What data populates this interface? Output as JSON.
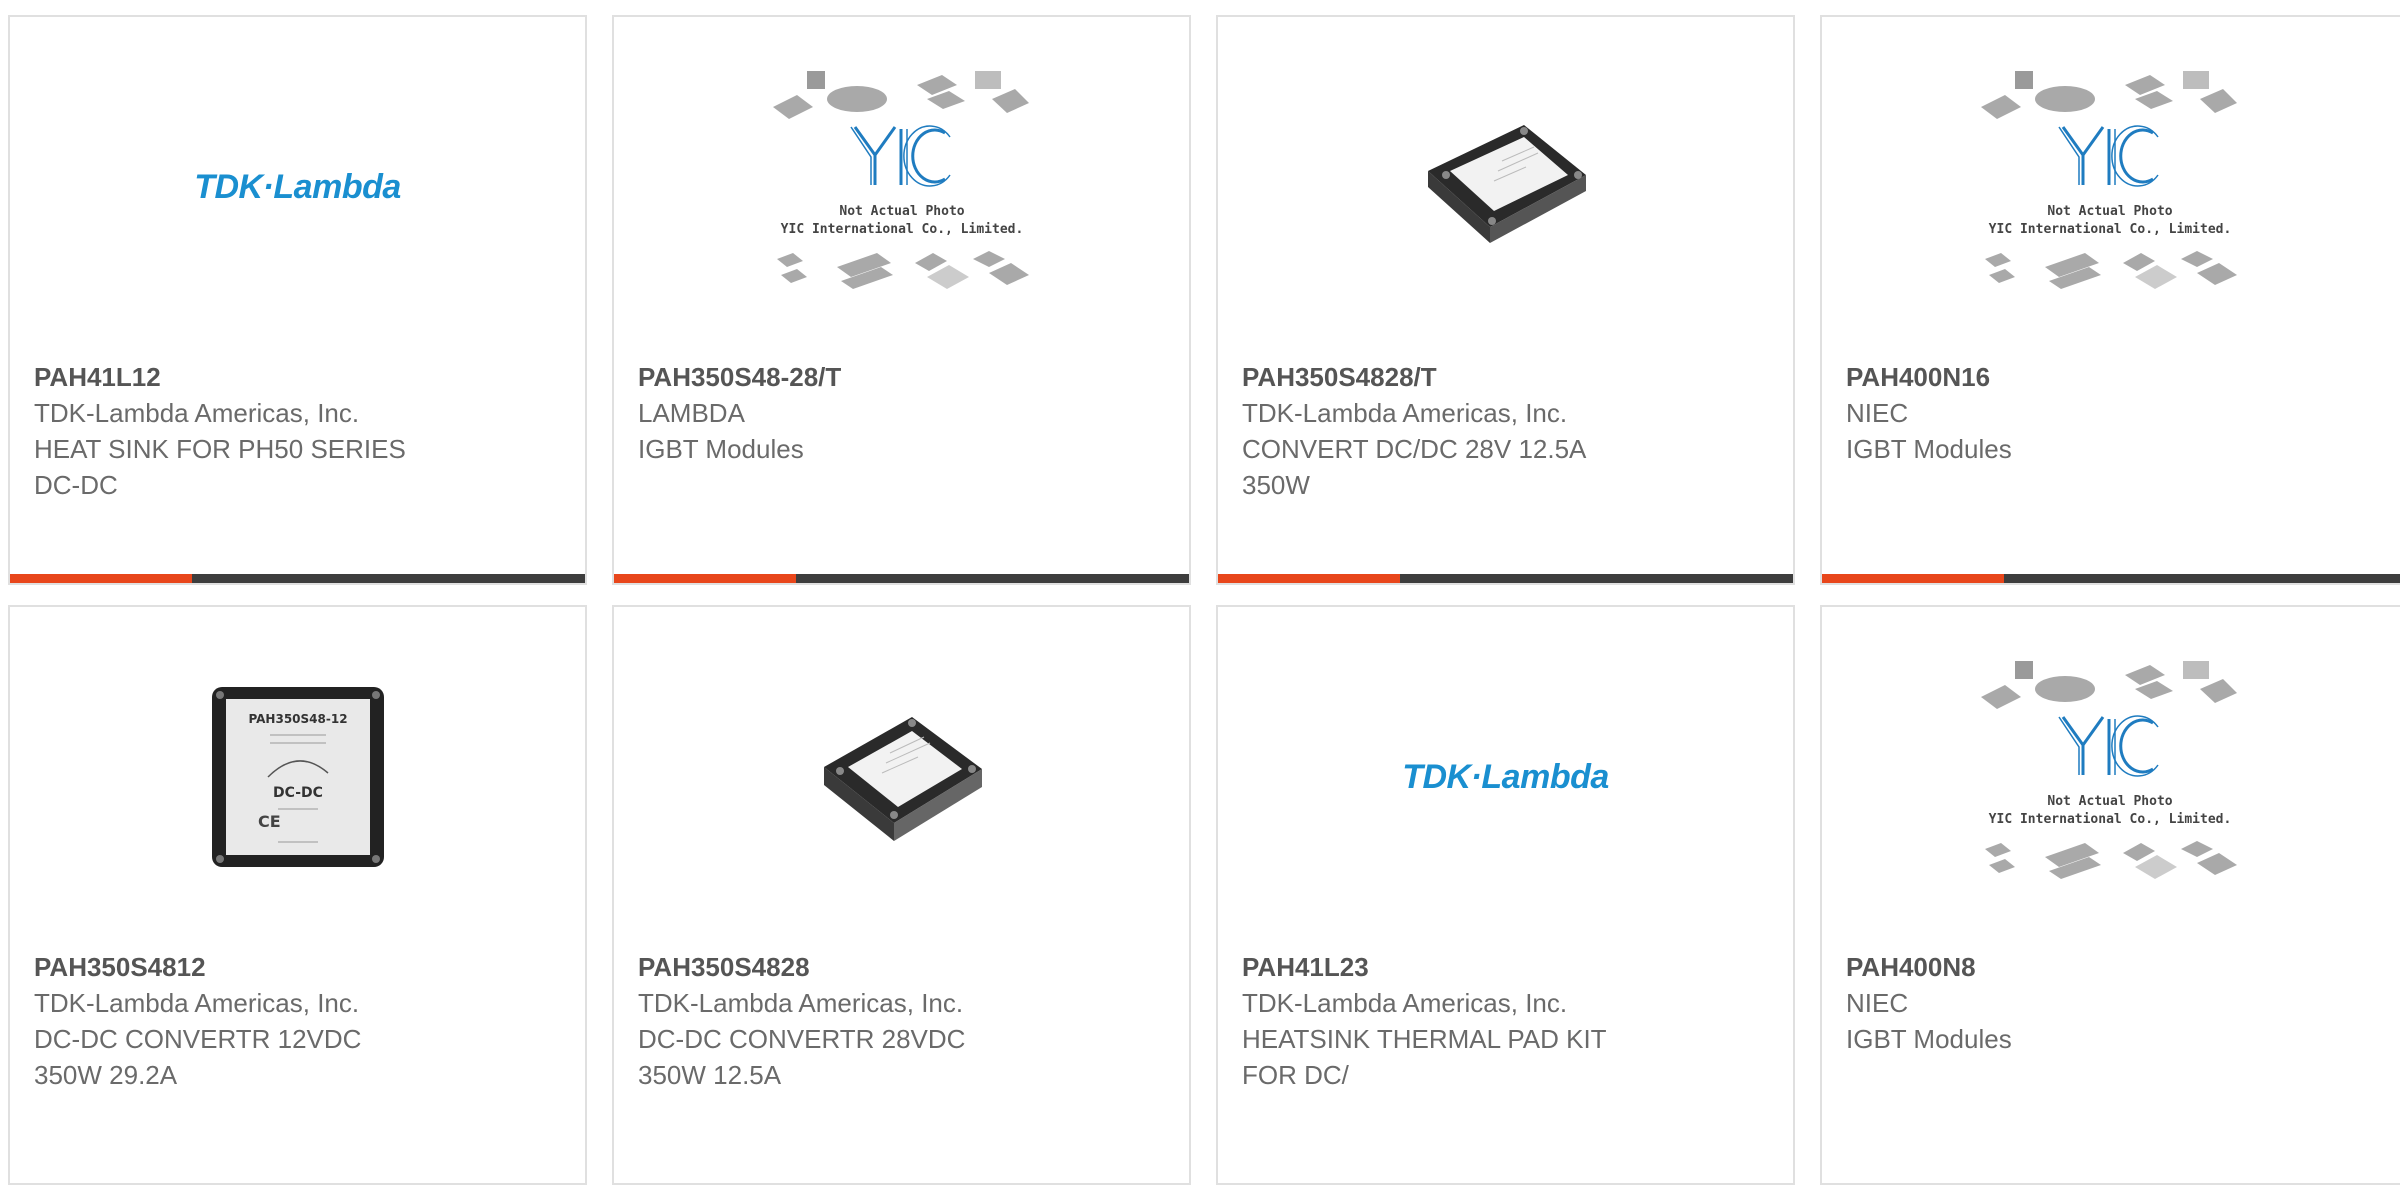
{
  "colors": {
    "accent": "#e8461b",
    "bar": "#3d3d3d",
    "tdk_blue": "#1a8fd0",
    "yic_blue": "#1f7cc0"
  },
  "placeholder": {
    "line1": "Not Actual Photo",
    "line2": "YIC International Co., Limited.",
    "mark": "YIC"
  },
  "tdk_logo_text": "TDK·Lambda",
  "products": [
    {
      "part": "PAH41L12",
      "manufacturer": "TDK-Lambda Americas, Inc.",
      "description": "HEAT SINK FOR PH50 SERIES\nDC-DC",
      "image": "tdk-logo"
    },
    {
      "part": "PAH350S48-28/T",
      "manufacturer": "LAMBDA",
      "description": "IGBT Modules",
      "image": "placeholder"
    },
    {
      "part": "PAH350S4828/T",
      "manufacturer": "TDK-Lambda Americas, Inc.",
      "description": "CONVERT DC/DC 28V 12.5A\n350W",
      "image": "module-angled"
    },
    {
      "part": "PAH400N16",
      "manufacturer": "NIEC",
      "description": "IGBT Modules",
      "image": "placeholder"
    },
    {
      "part": "PAH350S4812",
      "manufacturer": "TDK-Lambda Americas, Inc.",
      "description": "DC-DC CONVERTR 12VDC\n350W 29.2A",
      "image": "module-top",
      "module_label": "PAH350S48-12",
      "module_sub": "DC-DC"
    },
    {
      "part": "PAH350S4828",
      "manufacturer": "TDK-Lambda Americas, Inc.",
      "description": "DC-DC CONVERTR 28VDC\n350W 12.5A",
      "image": "module-angled"
    },
    {
      "part": "PAH41L23",
      "manufacturer": "TDK-Lambda Americas, Inc.",
      "description": "HEATSINK THERMAL PAD KIT\nFOR DC/",
      "image": "tdk-logo"
    },
    {
      "part": "PAH400N8",
      "manufacturer": "NIEC",
      "description": "IGBT Modules",
      "image": "placeholder"
    }
  ]
}
